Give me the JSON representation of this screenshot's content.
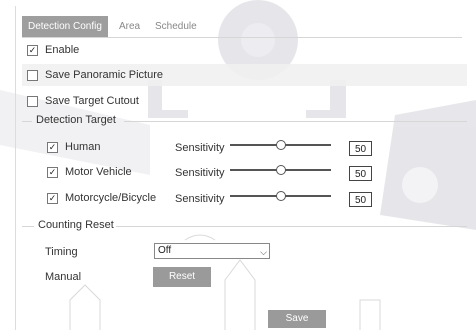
{
  "tabs": [
    {
      "label": "Detection Config",
      "active": true
    },
    {
      "label": "Area",
      "active": false
    },
    {
      "label": "Schedule",
      "active": false
    }
  ],
  "enable": {
    "label": "Enable",
    "checked": true
  },
  "save_panoramic": {
    "label": "Save Panoramic Picture",
    "checked": false
  },
  "save_target_cutout": {
    "label": "Save Target Cutout",
    "checked": false
  },
  "detection_target": {
    "title": "Detection Target",
    "sensitivity_label": "Sensitivity",
    "items": [
      {
        "label": "Human",
        "checked": true,
        "sensitivity": 50,
        "max": 100
      },
      {
        "label": "Motor Vehicle",
        "checked": true,
        "sensitivity": 50,
        "max": 100
      },
      {
        "label": "Motorcycle/Bicycle",
        "checked": true,
        "sensitivity": 50,
        "max": 100
      }
    ]
  },
  "counting_reset": {
    "title": "Counting Reset",
    "timing_label": "Timing",
    "timing_value": "Off",
    "manual_label": "Manual",
    "reset_label": "Reset"
  },
  "save_label": "Save",
  "colors": {
    "button": "#9a9a9a",
    "tab_active": "#9e9e9e"
  }
}
